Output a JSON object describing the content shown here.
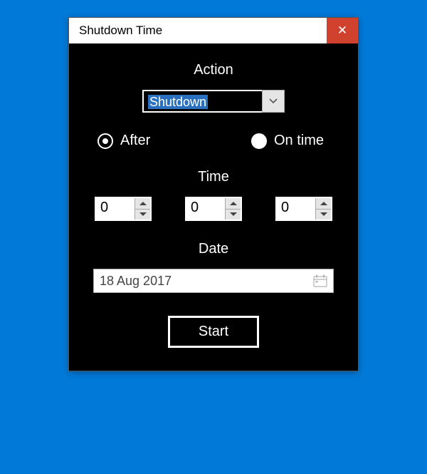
{
  "window": {
    "title": "Shutdown Time"
  },
  "action": {
    "label": "Action",
    "selected": "Shutdown"
  },
  "mode": {
    "after": "After",
    "on_time": "On time",
    "selected": "after"
  },
  "time": {
    "label": "Time",
    "h": "0",
    "m": "0",
    "s": "0"
  },
  "date": {
    "label": "Date",
    "value": "18 Aug 2017"
  },
  "buttons": {
    "start": "Start"
  }
}
